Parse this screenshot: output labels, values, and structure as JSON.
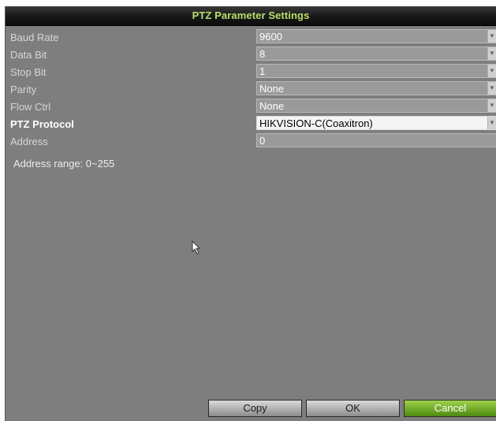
{
  "window": {
    "title": "PTZ Parameter Settings"
  },
  "fields": [
    {
      "label": "Baud Rate",
      "value": "9600",
      "type": "dropdown"
    },
    {
      "label": "Data Bit",
      "value": "8",
      "type": "dropdown"
    },
    {
      "label": "Stop Bit",
      "value": "1",
      "type": "dropdown"
    },
    {
      "label": "Parity",
      "value": "None",
      "type": "dropdown"
    },
    {
      "label": "Flow Ctrl",
      "value": "None",
      "type": "dropdown"
    },
    {
      "label": "PTZ Protocol",
      "value": "HIKVISION-C(Coaxitron)",
      "type": "dropdown",
      "focused": true
    },
    {
      "label": "Address",
      "value": "0",
      "type": "text"
    }
  ],
  "hint": "Address range: 0~255",
  "buttons": {
    "copy": "Copy",
    "ok": "OK",
    "cancel": "Cancel"
  },
  "colors": {
    "title": "#b8e06a",
    "panel": "#7e7e7e",
    "cancel_button": "#6aa824"
  },
  "icons": {
    "dropdown": "chevron-down-icon",
    "pointer": "mouse-cursor-icon"
  }
}
